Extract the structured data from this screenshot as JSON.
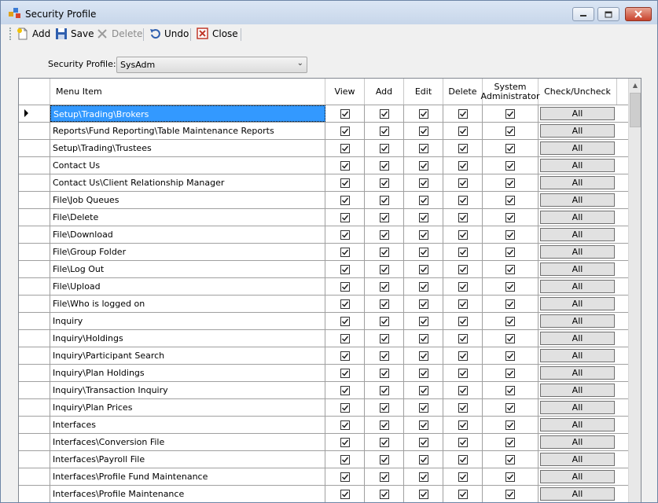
{
  "window": {
    "title": "Security Profile",
    "controls": {
      "minimize": "minimize",
      "maximize": "maximize",
      "close": "close"
    }
  },
  "toolbar": {
    "add_label": "Add",
    "save_label": "Save",
    "delete_label": "Delete",
    "undo_label": "Undo",
    "close_label": "Close"
  },
  "profile": {
    "label": "Security Profile:",
    "value": "SysAdm"
  },
  "grid": {
    "headers": {
      "menu_item": "Menu Item",
      "view": "View",
      "add": "Add",
      "edit": "Edit",
      "delete": "Delete",
      "sysadmin_line1": "System",
      "sysadmin_line2": "Administrator",
      "check_uncheck": "Check/Uncheck"
    },
    "all_button_label": "All",
    "selected_row": 0,
    "rows": [
      {
        "menu_item": "Setup\\Trading\\Brokers",
        "view": true,
        "add": true,
        "edit": true,
        "delete": true,
        "sysadmin": true
      },
      {
        "menu_item": "Reports\\Fund Reporting\\Table Maintenance Reports",
        "view": true,
        "add": true,
        "edit": true,
        "delete": true,
        "sysadmin": true
      },
      {
        "menu_item": "Setup\\Trading\\Trustees",
        "view": true,
        "add": true,
        "edit": true,
        "delete": true,
        "sysadmin": true
      },
      {
        "menu_item": "Contact Us",
        "view": true,
        "add": true,
        "edit": true,
        "delete": true,
        "sysadmin": true
      },
      {
        "menu_item": "Contact Us\\Client Relationship Manager",
        "view": true,
        "add": true,
        "edit": true,
        "delete": true,
        "sysadmin": true
      },
      {
        "menu_item": "File\\Job Queues",
        "view": true,
        "add": true,
        "edit": true,
        "delete": true,
        "sysadmin": true
      },
      {
        "menu_item": "File\\Delete",
        "view": true,
        "add": true,
        "edit": true,
        "delete": true,
        "sysadmin": true
      },
      {
        "menu_item": "File\\Download",
        "view": true,
        "add": true,
        "edit": true,
        "delete": true,
        "sysadmin": true
      },
      {
        "menu_item": "File\\Group Folder",
        "view": true,
        "add": true,
        "edit": true,
        "delete": true,
        "sysadmin": true
      },
      {
        "menu_item": "File\\Log Out",
        "view": true,
        "add": true,
        "edit": true,
        "delete": true,
        "sysadmin": true
      },
      {
        "menu_item": "File\\Upload",
        "view": true,
        "add": true,
        "edit": true,
        "delete": true,
        "sysadmin": true
      },
      {
        "menu_item": "File\\Who is logged on",
        "view": true,
        "add": true,
        "edit": true,
        "delete": true,
        "sysadmin": true
      },
      {
        "menu_item": "Inquiry",
        "view": true,
        "add": true,
        "edit": true,
        "delete": true,
        "sysadmin": true
      },
      {
        "menu_item": "Inquiry\\Holdings",
        "view": true,
        "add": true,
        "edit": true,
        "delete": true,
        "sysadmin": true
      },
      {
        "menu_item": "Inquiry\\Participant Search",
        "view": true,
        "add": true,
        "edit": true,
        "delete": true,
        "sysadmin": true
      },
      {
        "menu_item": "Inquiry\\Plan Holdings",
        "view": true,
        "add": true,
        "edit": true,
        "delete": true,
        "sysadmin": true
      },
      {
        "menu_item": "Inquiry\\Transaction Inquiry",
        "view": true,
        "add": true,
        "edit": true,
        "delete": true,
        "sysadmin": true
      },
      {
        "menu_item": "Inquiry\\Plan Prices",
        "view": true,
        "add": true,
        "edit": true,
        "delete": true,
        "sysadmin": true
      },
      {
        "menu_item": "Interfaces",
        "view": true,
        "add": true,
        "edit": true,
        "delete": true,
        "sysadmin": true
      },
      {
        "menu_item": "Interfaces\\Conversion File",
        "view": true,
        "add": true,
        "edit": true,
        "delete": true,
        "sysadmin": true
      },
      {
        "menu_item": "Interfaces\\Payroll File",
        "view": true,
        "add": true,
        "edit": true,
        "delete": true,
        "sysadmin": true
      },
      {
        "menu_item": "Interfaces\\Profile Fund Maintenance",
        "view": true,
        "add": true,
        "edit": true,
        "delete": true,
        "sysadmin": true
      },
      {
        "menu_item": "Interfaces\\Profile Maintenance",
        "view": true,
        "add": true,
        "edit": true,
        "delete": true,
        "sysadmin": true
      }
    ]
  }
}
